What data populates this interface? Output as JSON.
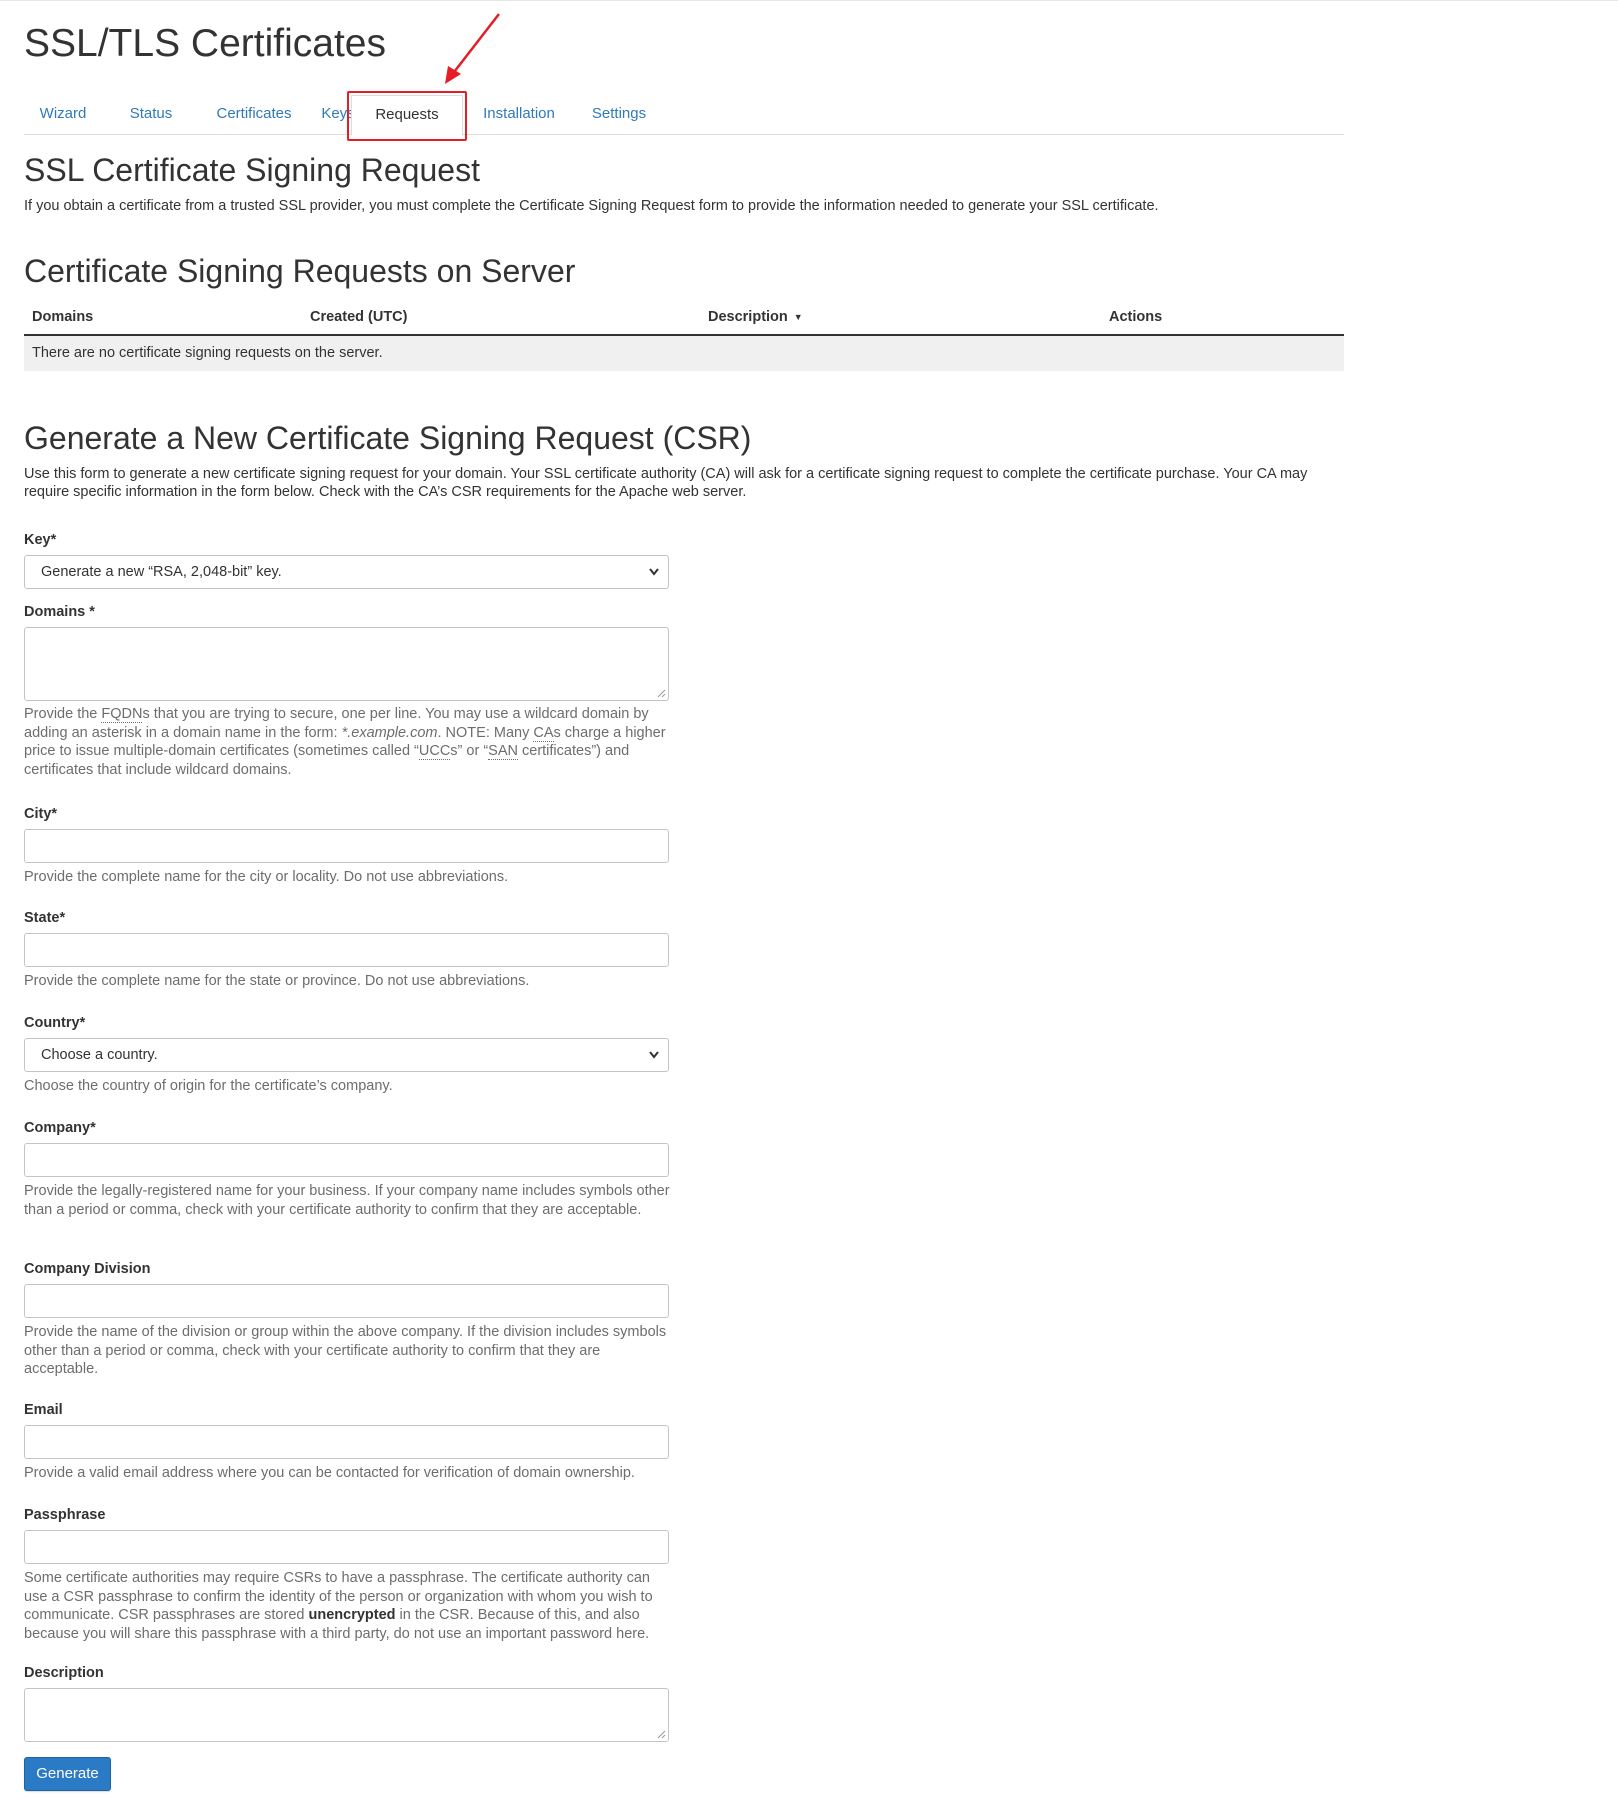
{
  "header": {
    "title": "SSL/TLS Certificates"
  },
  "tabs": [
    {
      "label": "Wizard"
    },
    {
      "label": "Status"
    },
    {
      "label": "Certificates"
    },
    {
      "label": "Keys"
    },
    {
      "label": "Requests"
    },
    {
      "label": "Installation"
    },
    {
      "label": "Settings"
    }
  ],
  "active_tab": "Requests",
  "annotation": {
    "highlight_color": "#e51e25"
  },
  "csr_section": {
    "title": "SSL Certificate Signing Request",
    "intro": "If you obtain a certificate from a trusted SSL provider, you must complete the Certificate Signing Request form to provide the information needed to generate your SSL certificate."
  },
  "server_section": {
    "title": "Certificate Signing Requests on Server",
    "columns": [
      "Domains",
      "Created (UTC)",
      "Description",
      "Actions"
    ],
    "sort_icon": "sort-desc-icon",
    "empty_message": "There are no certificate signing requests on the server."
  },
  "generate_section": {
    "title": "Generate a New Certificate Signing Request (CSR)",
    "intro": "Use this form to generate a new certificate signing request for your domain. Your SSL certificate authority (CA) will ask for a certificate signing request to complete the certificate purchase. Your CA may require specific information in the form below. Check with the CA’s CSR requirements for the Apache web server."
  },
  "form": {
    "key": {
      "label": "Key*",
      "selected": "Generate a new “RSA, 2,048-bit” key."
    },
    "domains": {
      "label": "Domains *",
      "value": "",
      "help": {
        "p1": "Provide the ",
        "abbr1": "FQDN",
        "p2": "s that you are trying to secure, one per line. You may use a wildcard domain by adding an asterisk in a domain name in the form: ",
        "example": "*.example.com",
        "p3": ". NOTE: Many ",
        "abbr2": "CA",
        "p4": "s charge a higher price to issue multiple-domain certificates (sometimes called “",
        "abbr3": "UCC",
        "p5": "s” or “",
        "abbr4": "SAN",
        "p6": " certificates”) and certificates that include wildcard domains."
      }
    },
    "city": {
      "label": "City*",
      "value": "",
      "help": "Provide the complete name for the city or locality. Do not use abbreviations."
    },
    "state": {
      "label": "State*",
      "value": "",
      "help": "Provide the complete name for the state or province. Do not use abbreviations."
    },
    "country": {
      "label": "Country*",
      "selected": "Choose a country.",
      "help": "Choose the country of origin for the certificate’s company."
    },
    "company": {
      "label": "Company*",
      "value": "",
      "help": "Provide the legally-registered name for your business. If your company name includes symbols other than a period or comma, check with your certificate authority to confirm that they are acceptable."
    },
    "division": {
      "label": "Company Division",
      "value": "",
      "help": "Provide the name of the division or group within the above company. If the division includes symbols other than a period or comma, check with your certificate authority to confirm that they are acceptable."
    },
    "email": {
      "label": "Email",
      "value": "",
      "help": "Provide a valid email address where you can be contacted for verification of domain ownership."
    },
    "passphrase": {
      "label": "Passphrase",
      "value": "",
      "help": {
        "p1": "Some certificate authorities may require CSRs to have a passphrase. The certificate authority can use a CSR passphrase to confirm the identity of the person or organization with whom you wish to communicate. CSR passphrases are stored ",
        "strong": "unencrypted",
        "p2": " in the CSR. Because of this, and also because you will share this passphrase with a third party, do not use an important password here."
      }
    },
    "description": {
      "label": "Description",
      "value": ""
    },
    "submit_label": "Generate"
  },
  "icons": {
    "dropdown": "chevron-down-icon",
    "arrow": "red-arrow-icon"
  }
}
